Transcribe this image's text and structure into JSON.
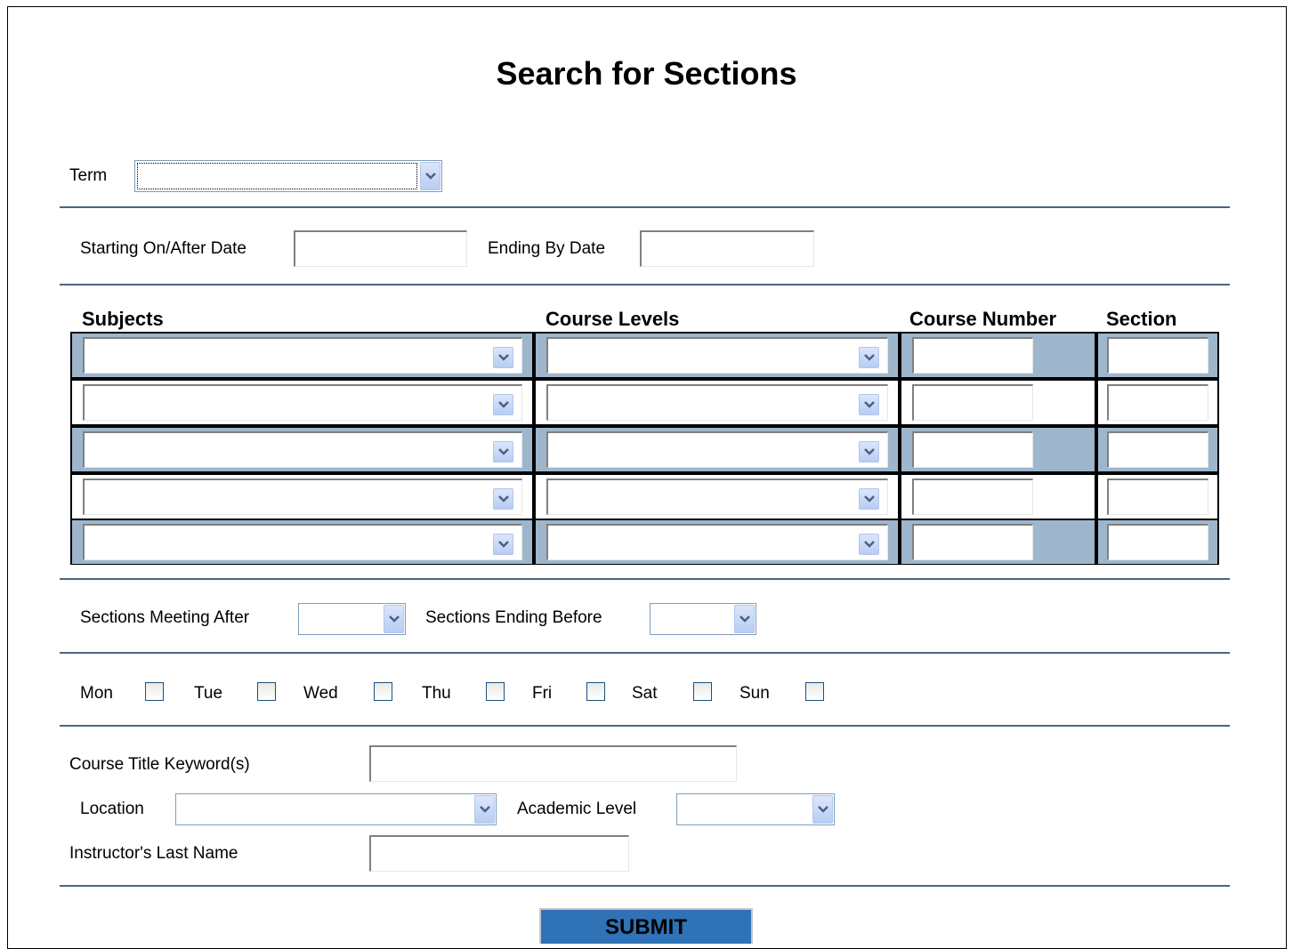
{
  "title": "Search for Sections",
  "term": {
    "label": "Term",
    "value": ""
  },
  "dates": {
    "start_label": "Starting On/After Date",
    "start_value": "",
    "end_label": "Ending By Date",
    "end_value": ""
  },
  "grid": {
    "headers": {
      "subjects": "Subjects",
      "levels": "Course Levels",
      "number": "Course Number",
      "section": "Section"
    },
    "rows": [
      {
        "subject": "",
        "level": "",
        "number": "",
        "section": ""
      },
      {
        "subject": "",
        "level": "",
        "number": "",
        "section": ""
      },
      {
        "subject": "",
        "level": "",
        "number": "",
        "section": ""
      },
      {
        "subject": "",
        "level": "",
        "number": "",
        "section": ""
      },
      {
        "subject": "",
        "level": "",
        "number": "",
        "section": ""
      }
    ],
    "shade_color": "#9eb6cc"
  },
  "times": {
    "after_label": "Sections Meeting After",
    "after_value": "",
    "before_label": "Sections Ending Before",
    "before_value": ""
  },
  "days": [
    {
      "label": "Mon",
      "checked": false
    },
    {
      "label": "Tue",
      "checked": false
    },
    {
      "label": "Wed",
      "checked": false
    },
    {
      "label": "Thu",
      "checked": false
    },
    {
      "label": "Fri",
      "checked": false
    },
    {
      "label": "Sat",
      "checked": false
    },
    {
      "label": "Sun",
      "checked": false
    }
  ],
  "keyword": {
    "label": "Course Title Keyword(s)",
    "value": ""
  },
  "location": {
    "label": "Location",
    "value": ""
  },
  "academic_level": {
    "label": "Academic Level",
    "value": ""
  },
  "instructor": {
    "label": "Instructor's Last Name",
    "value": ""
  },
  "submit_label": "SUBMIT",
  "colors": {
    "rule": "#4b6486",
    "submit_bg": "#2f72b6"
  },
  "icons": {
    "dropdown": "chevron-down-icon"
  }
}
